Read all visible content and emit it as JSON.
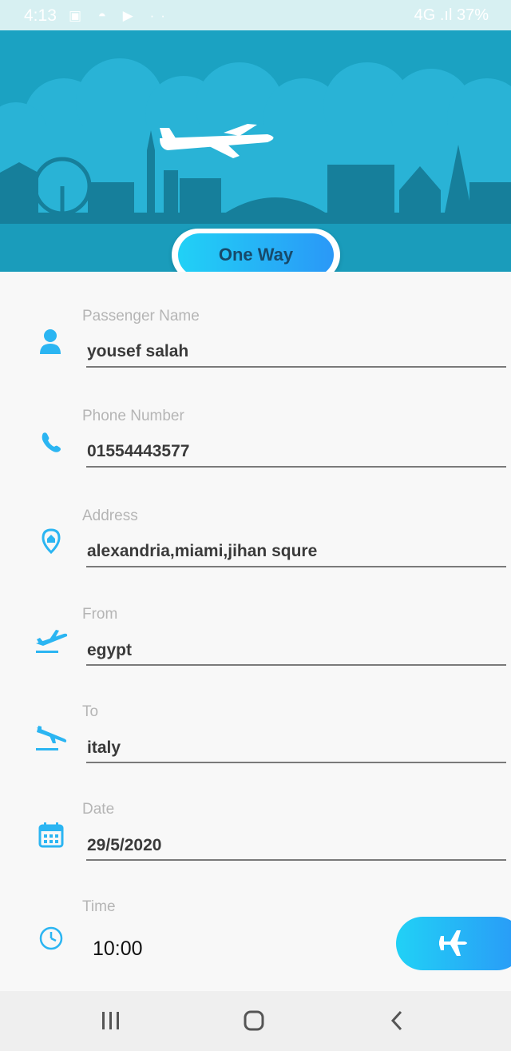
{
  "status_bar": {
    "time": "4:13",
    "icons": "▣ ◓ ▶ ··",
    "right_text": "4G .ıl 37%"
  },
  "header": {
    "trip_type_label": "One Way"
  },
  "fields": [
    {
      "label": "Passenger Name",
      "value": "yousef salah",
      "icon": "person-icon"
    },
    {
      "label": "Phone Number",
      "value": "01554443577",
      "icon": "phone-icon"
    },
    {
      "label": "Address",
      "value": "alexandria,miami,jihan squre",
      "icon": "location-icon"
    },
    {
      "label": "From",
      "value": "egypt",
      "icon": "takeoff-icon"
    },
    {
      "label": "To",
      "value": "italy",
      "icon": "landing-icon"
    },
    {
      "label": "Date",
      "value": "29/5/2020",
      "icon": "calendar-icon"
    },
    {
      "label": "Time",
      "value": "10:00",
      "icon": "clock-icon"
    }
  ],
  "colors": {
    "accent": "#2bb5f2",
    "hero_background": "#1ba2c2",
    "button_gradient_start": "#21d1f6",
    "button_gradient_end": "#2a98f7"
  },
  "navigation": {
    "recents_icon": "recents-icon",
    "home_icon": "home-icon",
    "back_icon": "back-icon"
  }
}
